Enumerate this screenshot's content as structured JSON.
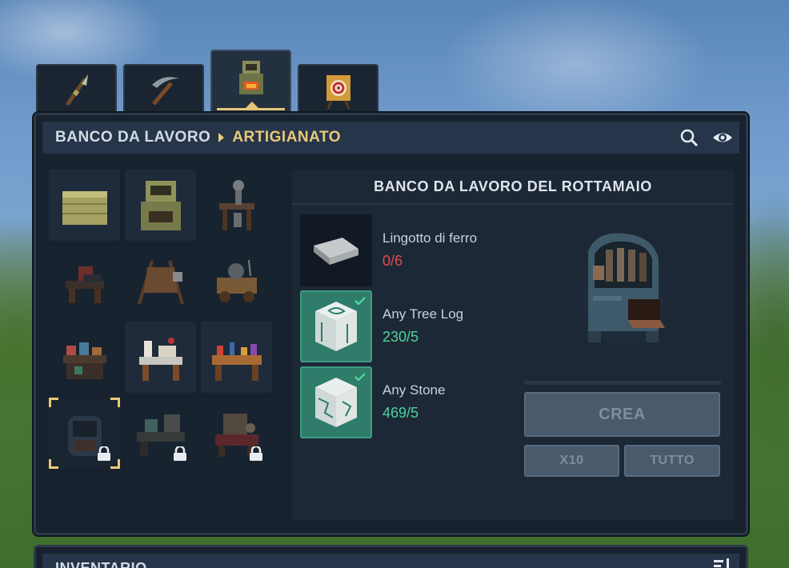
{
  "tabs": [
    {
      "name": "weapons",
      "icon": "spear-icon",
      "active": false
    },
    {
      "name": "tools",
      "icon": "pickaxe-icon",
      "active": false
    },
    {
      "name": "workbenches",
      "icon": "workbench-icon",
      "active": true
    },
    {
      "name": "decor",
      "icon": "target-icon",
      "active": false
    }
  ],
  "breadcrumb": {
    "parent": "BANCO DA LAVORO",
    "current": "ARTIGIANATO"
  },
  "header_icons": [
    "search-icon",
    "eye-icon"
  ],
  "recipes": [
    {
      "icon": "crate-icon",
      "locked": false,
      "selected": false
    },
    {
      "icon": "furnace-icon",
      "locked": false,
      "selected": false
    },
    {
      "icon": "skeleton-bench-icon",
      "locked": false,
      "selected": false
    },
    {
      "icon": "anvil-icon",
      "locked": false,
      "selected": false
    },
    {
      "icon": "tanning-rack-icon",
      "locked": false,
      "selected": false
    },
    {
      "icon": "cart-icon",
      "locked": false,
      "selected": false
    },
    {
      "icon": "alchemy-bench-icon",
      "locked": false,
      "selected": false
    },
    {
      "icon": "tailor-bench-icon",
      "locked": false,
      "selected": false
    },
    {
      "icon": "tinker-bench-icon",
      "locked": false,
      "selected": false
    },
    {
      "icon": "scrap-bench-icon",
      "locked": true,
      "selected": true
    },
    {
      "icon": "science-bench-icon",
      "locked": true,
      "selected": false
    },
    {
      "icon": "loom-icon",
      "locked": true,
      "selected": false
    }
  ],
  "detail": {
    "title": "BANCO DA LAVORO DEL ROTTAMAIO",
    "ingredients": [
      {
        "name": "Lingotto di ferro",
        "count": "0/6",
        "icon": "iron-ingot-icon",
        "ok": false
      },
      {
        "name": "Any Tree Log",
        "count": "230/5",
        "icon": "tree-log-icon",
        "ok": true
      },
      {
        "name": "Any Stone",
        "count": "469/5",
        "icon": "stone-icon",
        "ok": true
      }
    ],
    "preview_icon": "scrap-workbench-icon",
    "craft_label": "CREA",
    "x10_label": "X10",
    "all_label": "TUTTO"
  },
  "inventory": {
    "title": "INVENTARIO"
  },
  "colors": {
    "accent": "#e9c97a",
    "ok": "#4fd29a",
    "bad": "#e24c4c"
  }
}
